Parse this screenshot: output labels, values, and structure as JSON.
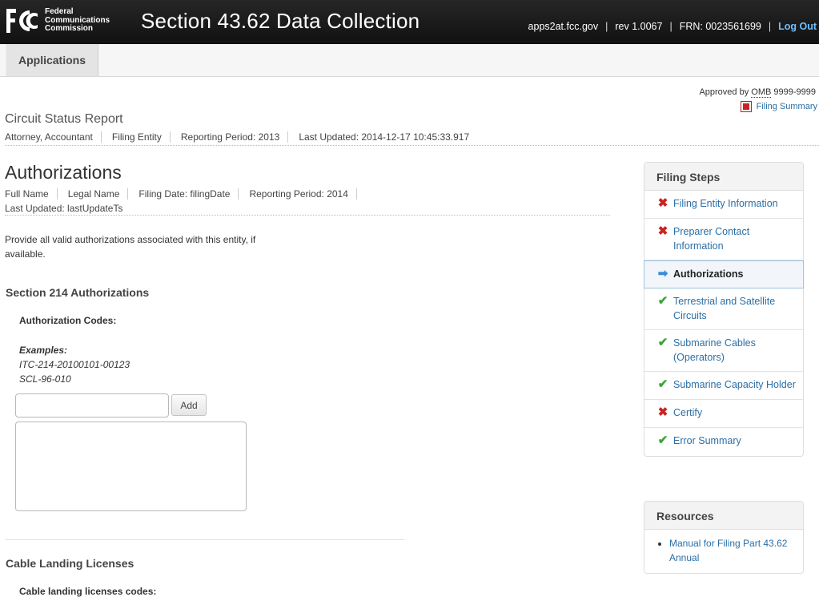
{
  "header": {
    "agency_lines": [
      "Federal",
      "Communications",
      "Commission"
    ],
    "app_title": "Section 43.62 Data Collection",
    "host": "apps2at.fcc.gov",
    "rev": "rev 1.0067",
    "frn": "FRN: 0023561699",
    "logout": "Log Out"
  },
  "nav": {
    "tab": "Applications"
  },
  "approval": {
    "approved_prefix": "Approved by",
    "omb": "OMB",
    "omb_number": "9999-9999",
    "filing_summary": "Filing Summary"
  },
  "report": {
    "title": "Circuit Status Report",
    "meta": [
      "Attorney, Accountant",
      "Filing Entity",
      "Reporting Period: 2013",
      "Last Updated: 2014-12-17 10:45:33.917"
    ]
  },
  "page": {
    "heading": "Authorizations",
    "meta": [
      "Full Name",
      "Legal Name",
      "Filing Date: filingDate",
      "Reporting Period: 2014"
    ],
    "last_updated": "Last Updated: lastUpdateTs",
    "instruction": "Provide all valid authorizations associated with this entity, if available."
  },
  "section214": {
    "heading": "Section 214 Authorizations",
    "codes_label": "Authorization Codes:",
    "examples_label": "Examples:",
    "examples": [
      "ITC-214-20100101-00123",
      "SCL-96-010"
    ],
    "input_value": "",
    "add_label": "Add"
  },
  "cable": {
    "heading": "Cable Landing Licenses",
    "codes_label": "Cable landing licenses codes:"
  },
  "filing_steps": {
    "title": "Filing Steps",
    "steps": [
      {
        "label": "Filing Entity Information",
        "status": "error",
        "icon": "x-icon"
      },
      {
        "label": "Preparer Contact Information",
        "status": "error",
        "icon": "x-icon"
      },
      {
        "label": "Authorizations",
        "status": "current",
        "icon": "arrow-right-icon"
      },
      {
        "label": "Terrestrial and Satellite Circuits",
        "status": "complete",
        "icon": "check-icon"
      },
      {
        "label": "Submarine Cables (Operators)",
        "status": "complete",
        "icon": "check-icon"
      },
      {
        "label": "Submarine Capacity Holder",
        "status": "complete",
        "icon": "check-icon"
      },
      {
        "label": "Certify",
        "status": "error",
        "icon": "x-icon"
      },
      {
        "label": "Error Summary",
        "status": "complete",
        "icon": "check-icon"
      }
    ]
  },
  "resources": {
    "title": "Resources",
    "items": [
      "Manual for Filing Part 43.62 Annual"
    ]
  },
  "colors": {
    "link": "#2a6ea6",
    "error": "#cc2222",
    "complete": "#3aa535",
    "current": "#3a8ed6",
    "header_bg": "#1c1c1c"
  }
}
